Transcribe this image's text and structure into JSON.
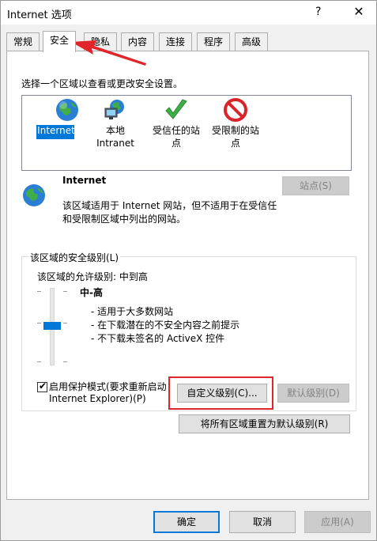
{
  "window": {
    "title": "Internet 选项",
    "help_label": "?",
    "close_label": "✕"
  },
  "tabs": [
    {
      "label": "常规"
    },
    {
      "label": "安全"
    },
    {
      "label": "隐私"
    },
    {
      "label": "内容"
    },
    {
      "label": "连接"
    },
    {
      "label": "程序"
    },
    {
      "label": "高级"
    }
  ],
  "active_tab": "安全",
  "security": {
    "instruction": "选择一个区域以查看或更改安全设置。",
    "zones": [
      {
        "line1": "Internet",
        "line2": "",
        "icon": "globe-icon",
        "selected": true
      },
      {
        "line1": "本地",
        "line2": "Intranet",
        "icon": "intranet-icon",
        "selected": false
      },
      {
        "line1": "受信任的站",
        "line2": "点",
        "icon": "check-icon",
        "selected": false
      },
      {
        "line1": "受限制的站",
        "line2": "点",
        "icon": "restricted-icon",
        "selected": false
      }
    ],
    "zone_detail": {
      "name": "Internet",
      "description_line1": "该区域适用于 Internet 网站，但不适用于在受信任",
      "description_line2": "和受限制区域中列出的网站。",
      "sites_button": "站点(S)"
    },
    "level_group": {
      "title": "该区域的安全级别(L)",
      "allowed_levels": "该区域的允许级别: 中到高",
      "level_name": "中-高",
      "bullets": [
        "- 适用于大多数网站",
        "- 在下载潜在的不安全内容之前提示",
        "- 不下载未签名的 ActiveX 控件"
      ],
      "protected_mode_line1": "启用保护模式(要求重新启动",
      "protected_mode_line2": "Internet Explorer)(P)",
      "protected_mode_checked": true,
      "custom_level_button": "自定义级别(C)...",
      "default_level_button": "默认级别(D)"
    },
    "reset_all_button": "将所有区域重置为默认级别(R)"
  },
  "footer": {
    "ok": "确定",
    "cancel": "取消",
    "apply": "应用(A)"
  },
  "colors": {
    "selection": "#0078d7",
    "highlight": "#e0262a"
  }
}
